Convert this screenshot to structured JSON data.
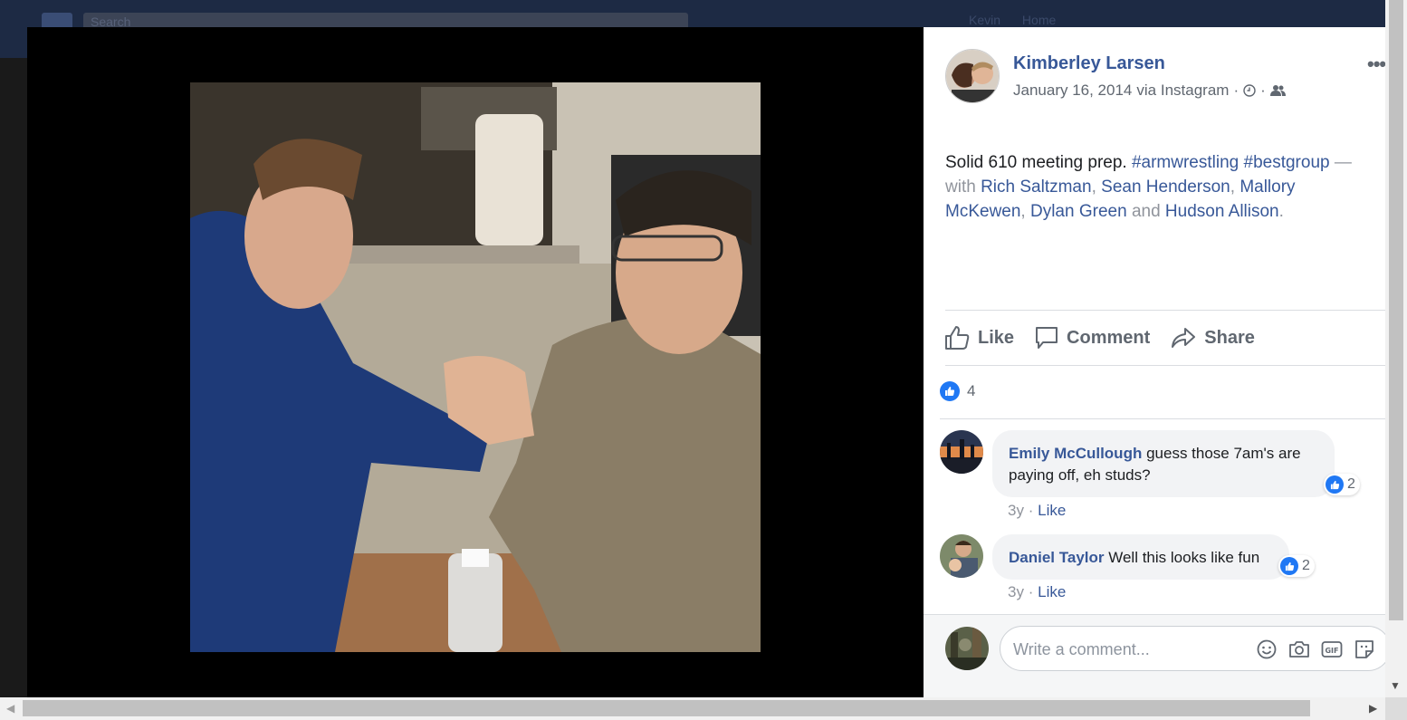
{
  "background": {
    "search_placeholder": "Search",
    "user_name": "Kevin",
    "home_label": "Home"
  },
  "post": {
    "author": "Kimberley Larsen",
    "date": "January 16, 2014",
    "via": "via Instagram",
    "caption": {
      "text": "Solid 610 meeting prep.",
      "hashtags": [
        "#armwrestling",
        "#bestgroup"
      ],
      "with_prefix": "— with",
      "tagged": [
        "Rich Saltzman",
        "Sean Henderson",
        "Mallory McKewen",
        "Dylan Green",
        "Hudson Allison"
      ],
      "and": "and",
      "period": "."
    },
    "actions": {
      "like": "Like",
      "comment": "Comment",
      "share": "Share"
    },
    "reaction_count": "4"
  },
  "comments": [
    {
      "author": "Emily McCullough",
      "text": "guess those 7am's are paying off, eh studs?",
      "reactions": "2",
      "age": "3y",
      "like_label": "Like"
    },
    {
      "author": "Daniel Taylor",
      "text": "Well this looks like fun",
      "reactions": "2",
      "age": "3y",
      "like_label": "Like"
    }
  ],
  "composer": {
    "placeholder": "Write a comment..."
  },
  "colors": {
    "link": "#385898",
    "like_blue": "#2078f4",
    "muted": "#606770"
  }
}
